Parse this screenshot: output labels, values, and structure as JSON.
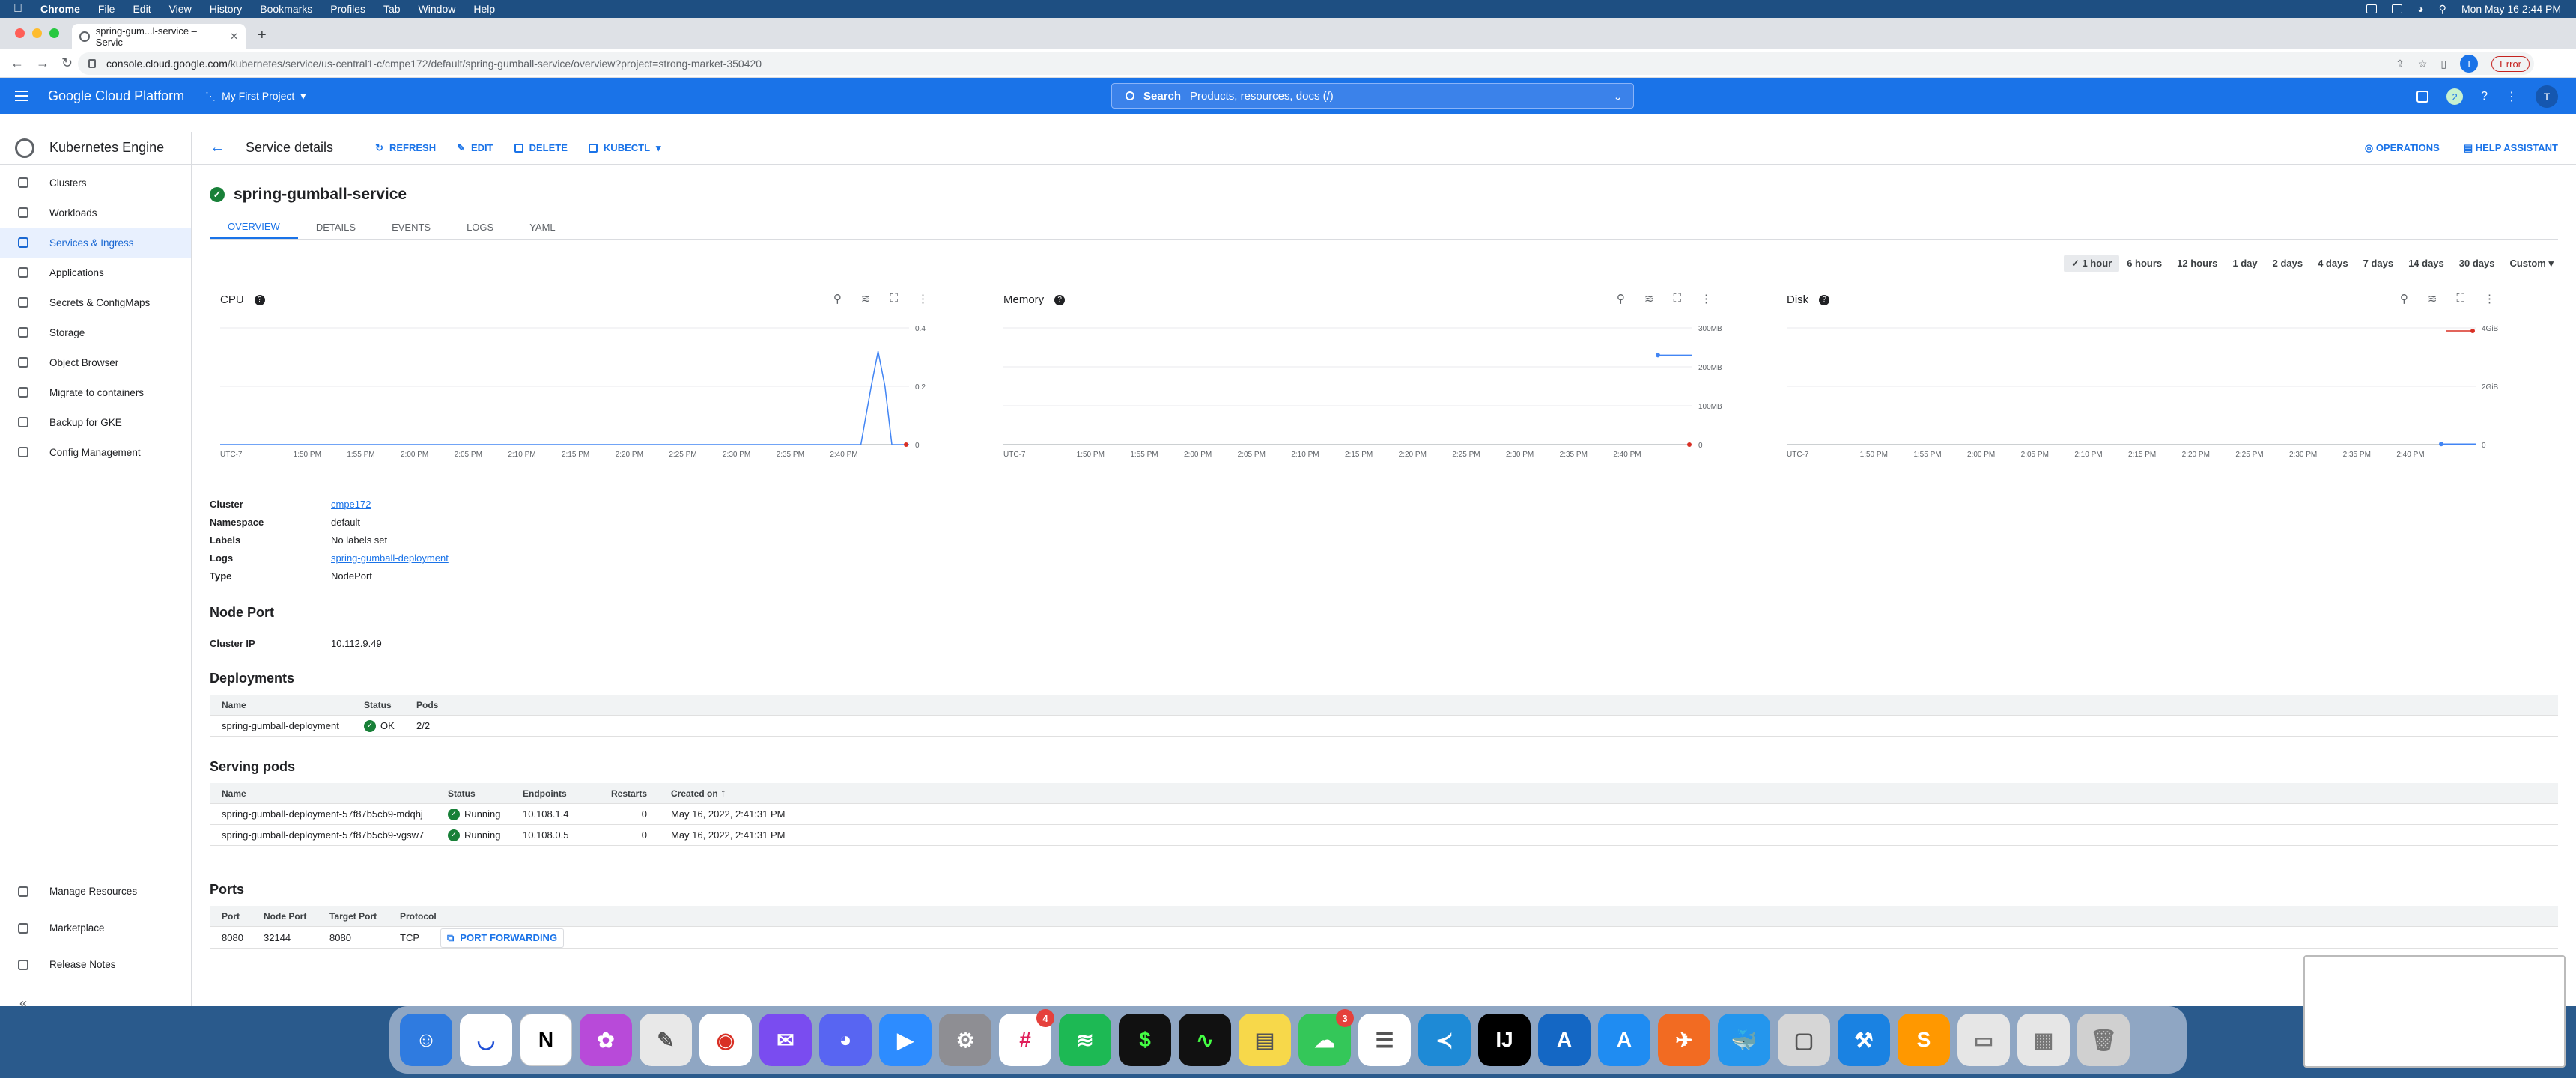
{
  "macmenu": {
    "app": "Chrome",
    "items": [
      "File",
      "Edit",
      "View",
      "History",
      "Bookmarks",
      "Profiles",
      "Tab",
      "Window",
      "Help"
    ],
    "datetime": "Mon May 16  2:44 PM"
  },
  "browser": {
    "tab_title": "spring-gum...l-service – Servic",
    "url_host": "console.cloud.google.com",
    "url_path": "/kubernetes/service/us-central1-c/cmpe172/default/spring-gumball-service/overview?project=strong-market-350420",
    "error_label": "Error",
    "avatar_letter": "T"
  },
  "gcp": {
    "title": "Google Cloud Platform",
    "project": "My First Project",
    "search_label": "Search",
    "search_placeholder": "Products, resources, docs (/)",
    "notif_count": "2",
    "avatar_letter": "T"
  },
  "sidebar": {
    "title": "Kubernetes Engine",
    "items": [
      {
        "label": "Clusters"
      },
      {
        "label": "Workloads"
      },
      {
        "label": "Services & Ingress"
      },
      {
        "label": "Applications"
      },
      {
        "label": "Secrets & ConfigMaps"
      },
      {
        "label": "Storage"
      },
      {
        "label": "Object Browser"
      },
      {
        "label": "Migrate to containers"
      },
      {
        "label": "Backup for GKE"
      },
      {
        "label": "Config Management"
      }
    ],
    "bottom": [
      {
        "label": "Manage Resources"
      },
      {
        "label": "Marketplace"
      },
      {
        "label": "Release Notes"
      }
    ]
  },
  "header": {
    "title": "Service details",
    "refresh": "REFRESH",
    "edit": "EDIT",
    "delete": "DELETE",
    "kubectl": "KUBECTL",
    "operations": "OPERATIONS",
    "help": "HELP ASSISTANT"
  },
  "service": {
    "name": "spring-gumball-service",
    "tabs": [
      "OVERVIEW",
      "DETAILS",
      "EVENTS",
      "LOGS",
      "YAML"
    ]
  },
  "timerange": [
    "1 hour",
    "6 hours",
    "12 hours",
    "1 day",
    "2 days",
    "4 days",
    "7 days",
    "14 days",
    "30 days",
    "Custom"
  ],
  "chart_data": [
    {
      "type": "line",
      "title": "CPU",
      "x": [
        "UTC-7",
        "1:50 PM",
        "1:55 PM",
        "2:00 PM",
        "2:05 PM",
        "2:10 PM",
        "2:15 PM",
        "2:20 PM",
        "2:25 PM",
        "2:30 PM",
        "2:35 PM",
        "2:40 PM"
      ],
      "yticks": [
        "0.4",
        "0.2",
        "0"
      ],
      "ylim": [
        0,
        0.4
      ],
      "series": [
        {
          "points": [
            [
              0.0,
              0
            ],
            [
              0.88,
              0
            ],
            [
              0.93,
              0
            ],
            [
              0.945,
              0.2
            ],
            [
              0.955,
              0.32
            ],
            [
              0.965,
              0.2
            ],
            [
              0.975,
              0
            ],
            [
              1.0,
              0
            ]
          ]
        }
      ],
      "color": "#4285f4"
    },
    {
      "type": "line",
      "title": "Memory",
      "x": [
        "UTC-7",
        "1:50 PM",
        "1:55 PM",
        "2:00 PM",
        "2:05 PM",
        "2:10 PM",
        "2:15 PM",
        "2:20 PM",
        "2:25 PM",
        "2:30 PM",
        "2:35 PM",
        "2:40 PM"
      ],
      "yticks": [
        "300MB",
        "200MB",
        "100MB",
        "0"
      ],
      "ylim": [
        0,
        300
      ],
      "series": [
        {
          "points": [
            [
              0.95,
              230
            ],
            [
              1.0,
              230
            ]
          ]
        }
      ],
      "color": "#4285f4"
    },
    {
      "type": "line",
      "title": "Disk",
      "x": [
        "UTC-7",
        "1:50 PM",
        "1:55 PM",
        "2:00 PM",
        "2:05 PM",
        "2:10 PM",
        "2:15 PM",
        "2:20 PM",
        "2:25 PM",
        "2:30 PM",
        "2:35 PM",
        "2:40 PM"
      ],
      "yticks": [
        "4GiB",
        "2GiB",
        "0"
      ],
      "ylim": [
        0,
        4
      ],
      "series": [
        {
          "points": [
            [
              0.95,
              0.02
            ],
            [
              1.0,
              0.02
            ]
          ]
        }
      ],
      "color": "#4285f4"
    }
  ],
  "props": [
    {
      "k": "Cluster",
      "v": "cmpe172",
      "link": true
    },
    {
      "k": "Namespace",
      "v": "default",
      "link": false
    },
    {
      "k": "Labels",
      "v": "No labels set",
      "link": false
    },
    {
      "k": "Logs",
      "v": "spring-gumball-deployment",
      "link": true
    },
    {
      "k": "Type",
      "v": "NodePort",
      "link": false
    }
  ],
  "nodeport": {
    "title": "Node Port",
    "cluster_ip_label": "Cluster IP",
    "cluster_ip": "10.112.9.49"
  },
  "deployments": {
    "title": "Deployments",
    "headers": [
      "Name",
      "Status",
      "Pods"
    ],
    "rows": [
      [
        "spring-gumball-deployment",
        "OK",
        "2/2"
      ]
    ]
  },
  "pods": {
    "title": "Serving pods",
    "headers": [
      "Name",
      "Status",
      "Endpoints",
      "Restarts",
      "Created on"
    ],
    "rows": [
      [
        "spring-gumball-deployment-57f87b5cb9-mdqhj",
        "Running",
        "10.108.1.4",
        "0",
        "May 16, 2022, 2:41:31 PM"
      ],
      [
        "spring-gumball-deployment-57f87b5cb9-vgsw7",
        "Running",
        "10.108.0.5",
        "0",
        "May 16, 2022, 2:41:31 PM"
      ]
    ]
  },
  "ports": {
    "title": "Ports",
    "headers": [
      "Port",
      "Node Port",
      "Target Port",
      "Protocol"
    ],
    "rows": [
      [
        "8080",
        "32144",
        "8080",
        "TCP"
      ]
    ],
    "forward": "PORT FORWARDING"
  },
  "dock": {
    "slack_badge": "4",
    "messages_badge": "3"
  }
}
